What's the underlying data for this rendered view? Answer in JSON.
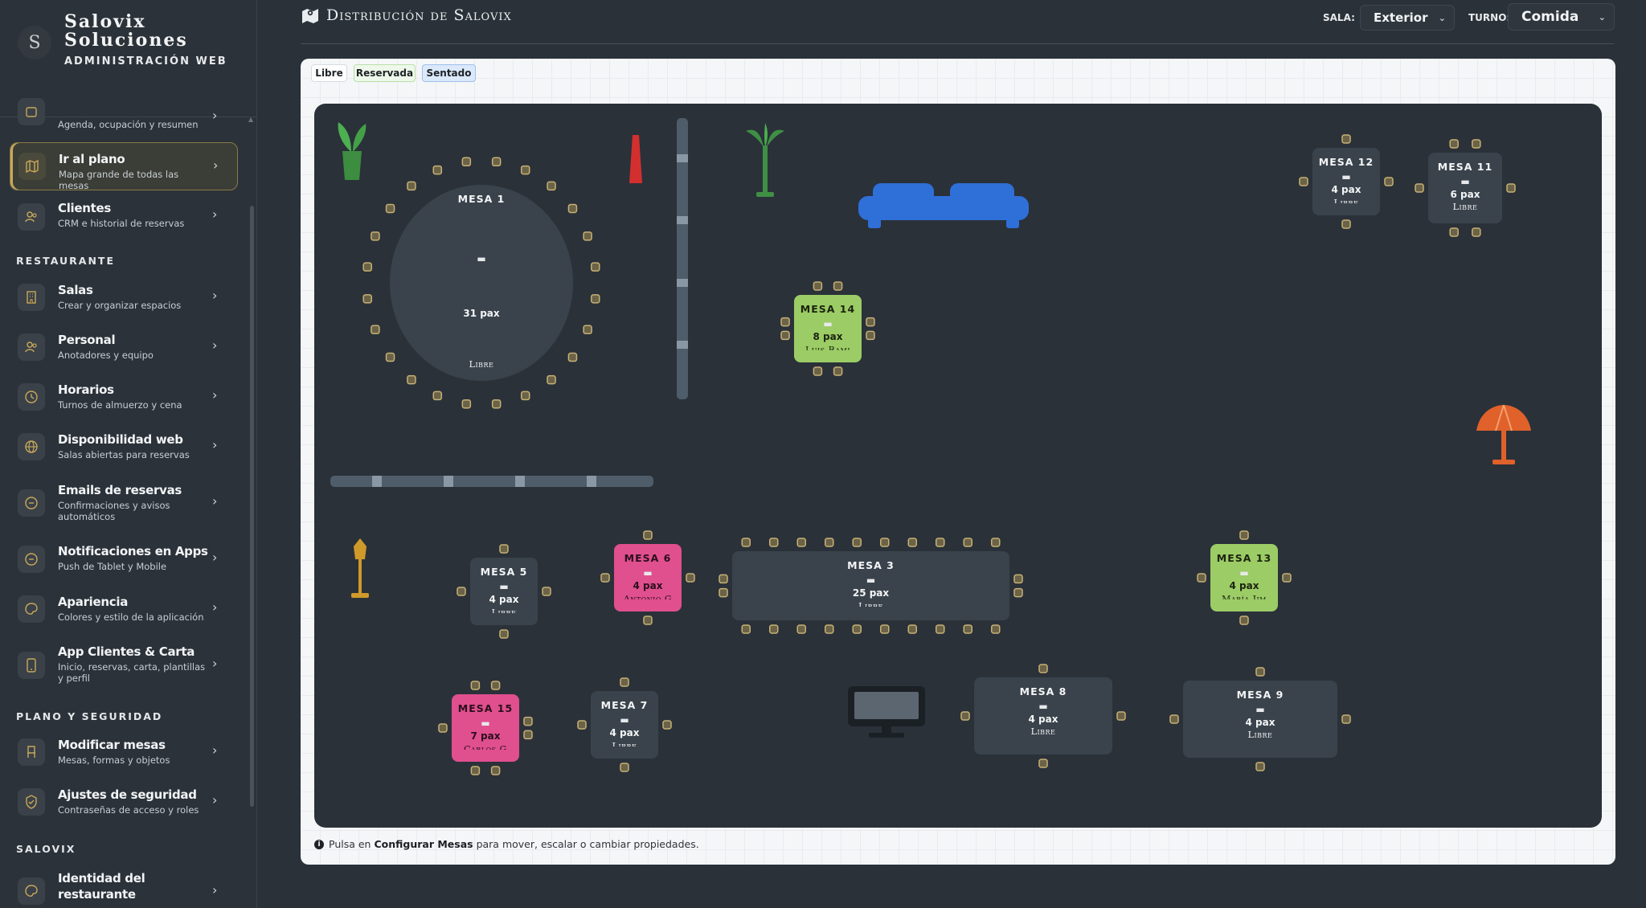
{
  "brand": {
    "name_line1": "Salovix",
    "name_line2": "Soluciones",
    "subtitle": "ADMINISTRACIÓN WEB",
    "logo_text": "S"
  },
  "sidebar": {
    "top_partial": {
      "desc": "Agenda, ocupación y resumen"
    },
    "items_top": [
      {
        "label": "Ir al plano",
        "desc": "Mapa grande de todas las mesas",
        "icon": "map-icon",
        "active": true
      },
      {
        "label": "Clientes",
        "desc": "CRM e historial de reservas",
        "icon": "users-icon"
      }
    ],
    "section_restaurante": "RESTAURANTE",
    "items_restaurante": [
      {
        "label": "Salas",
        "desc": "Crear y organizar espacios",
        "icon": "building-icon"
      },
      {
        "label": "Personal",
        "desc": "Anotadores y equipo",
        "icon": "users-icon"
      },
      {
        "label": "Horarios",
        "desc": "Turnos de almuerzo y cena",
        "icon": "clock-icon"
      },
      {
        "label": "Disponibilidad web",
        "desc": "Salas abiertas para reservas",
        "icon": "globe-icon"
      },
      {
        "label": "Emails de reservas",
        "desc": "Confirmaciones y avisos automáticos",
        "icon": "circle-minus-icon"
      },
      {
        "label": "Notificaciones en Apps",
        "desc": "Push de Tablet y Mobile",
        "icon": "circle-minus-icon"
      },
      {
        "label": "Apariencia",
        "desc": "Colores y estilo de la aplicación",
        "icon": "palette-icon"
      },
      {
        "label": "App Clientes & Carta",
        "desc": "Inicio, reservas, carta, plantillas y perfil",
        "icon": "phone-icon"
      }
    ],
    "section_plano": "PLANO Y SEGURIDAD",
    "items_plano": [
      {
        "label": "Modificar mesas",
        "desc": "Mesas, formas y objetos",
        "icon": "chair-icon"
      },
      {
        "label": "Ajustes de seguridad",
        "desc": "Contraseñas de acceso y roles",
        "icon": "shield-icon"
      }
    ],
    "section_salovix": "SALOVIX",
    "items_salovix": [
      {
        "label": "Identidad del restaurante",
        "desc": "",
        "icon": "palette-icon"
      }
    ]
  },
  "header": {
    "title": "Distribución de Salovix",
    "sala_label": "SALA:",
    "sala_value": "Exterior",
    "turno_label": "TURNO:",
    "turno_value": "Comida"
  },
  "legend": [
    {
      "label": "Libre",
      "bg": "#ffffff",
      "border": "#d7dbe0"
    },
    {
      "label": "Reservada",
      "bg": "#eef8ea",
      "border": "#b9dfa8"
    },
    {
      "label": "Sentado",
      "bg": "#dbe9fb",
      "border": "#9fc0ea"
    }
  ],
  "tables": [
    {
      "id": "mesa1",
      "name": "MESA 1",
      "pax": "31 pax",
      "status": "Libre"
    },
    {
      "id": "mesa14",
      "name": "MESA 14",
      "pax": "8 pax",
      "status": "Luis Rami"
    },
    {
      "id": "mesa12",
      "name": "MESA 12",
      "pax": "4 pax",
      "status": "Libre"
    },
    {
      "id": "mesa11",
      "name": "MESA 11",
      "pax": "6 pax",
      "status": "Libre"
    },
    {
      "id": "mesa5",
      "name": "MESA 5",
      "pax": "4 pax",
      "status": "Libre"
    },
    {
      "id": "mesa6",
      "name": "MESA 6",
      "pax": "4 pax",
      "status": "Antonio G"
    },
    {
      "id": "mesa3",
      "name": "MESA 3",
      "pax": "25 pax",
      "status": "Libre"
    },
    {
      "id": "mesa13",
      "name": "MESA 13",
      "pax": "4 pax",
      "status": "María Jim"
    },
    {
      "id": "mesa15",
      "name": "MESA 15",
      "pax": "7 pax",
      "status": "Carlos G"
    },
    {
      "id": "mesa7",
      "name": "MESA 7",
      "pax": "4 pax",
      "status": "Libre"
    },
    {
      "id": "mesa8",
      "name": "MESA 8",
      "pax": "4 pax",
      "status": "Libre"
    },
    {
      "id": "mesa9",
      "name": "MESA 9",
      "pax": "4 pax",
      "status": "Libre"
    }
  ],
  "footer": {
    "prefix": "Pulsa en",
    "bold": "Configurar Mesas",
    "suffix": "para mover, escalar o cambiar propiedades."
  },
  "colors": {
    "accent": "#c8a85a",
    "green": "#9ccc65",
    "pink": "#e04f8e",
    "sofa": "#2f6fd8",
    "umbrella": "#e0612a"
  }
}
